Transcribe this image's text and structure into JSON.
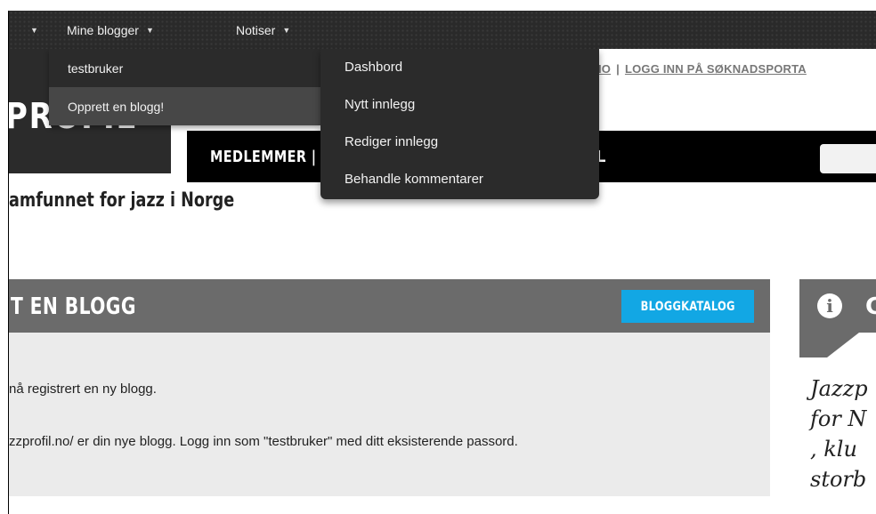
{
  "admin_bar": {
    "left_caret": "▼",
    "my_blogs": {
      "label": "Mine blogger",
      "caret": "▼"
    },
    "notices": {
      "label": "Notiser",
      "caret": "▼"
    }
  },
  "blogs_menu": {
    "items": [
      {
        "label": "testbruker"
      },
      {
        "label": "Opprett en blogg!"
      }
    ]
  },
  "blog_submenu": {
    "items": [
      {
        "label": "Dashbord"
      },
      {
        "label": "Nytt innlegg"
      },
      {
        "label": "Rediger innlegg"
      },
      {
        "label": "Behandle kommentarer"
      }
    ]
  },
  "site": {
    "top_links": {
      "link1": "IO",
      "separator": "|",
      "link2": "LOGG INN PÅ SØKNADSPORTA"
    },
    "logo_text": "PROFIL",
    "nav": {
      "medlemmer": "MEDLEMMER |",
      "trailing": "L"
    },
    "tagline": "amfunnet for jazz i Norge"
  },
  "main_panel": {
    "title": "T EN BLOGG",
    "catalog_button": "BLOGGKATALOG",
    "message_1": "nå registrert en ny blogg.",
    "message_2": "zzprofil.no/ er din nye blogg. Logg inn som \"testbruker\" med ditt eksisterende passord."
  },
  "sidebar": {
    "info_glyph": "i",
    "title_fragment": "C",
    "quote_lines": [
      "Jazzp",
      "for N",
      ", klu",
      "storb"
    ]
  },
  "colors": {
    "admin_bar": "#2a2a2a",
    "menu_bg": "#2b2b2b",
    "menu_hover": "#474747",
    "panel_header": "#6b6b6b",
    "panel_body": "#ebebeb",
    "accent_blue": "#12a7e4"
  }
}
